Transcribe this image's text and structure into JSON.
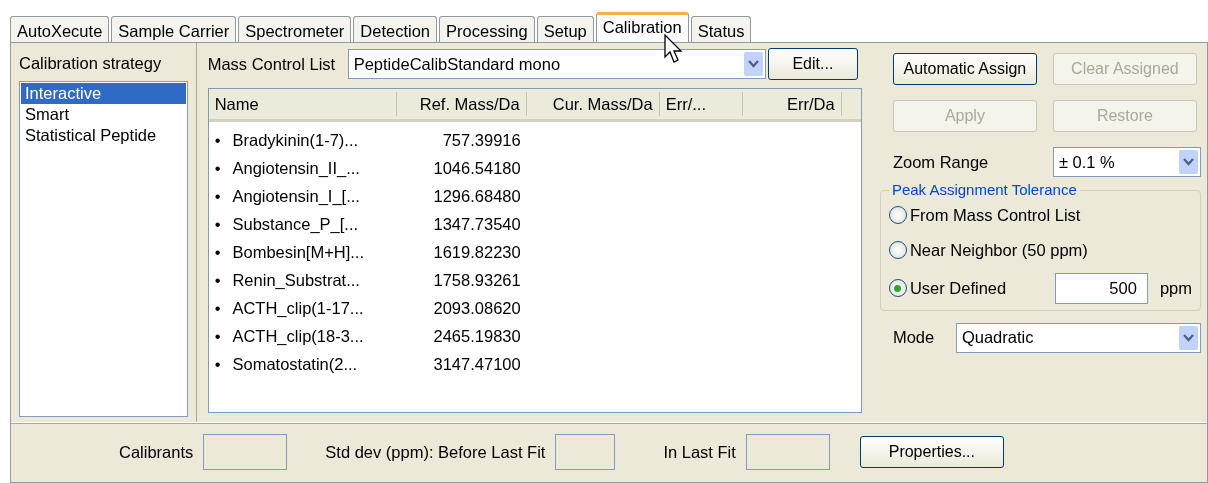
{
  "tabs": [
    {
      "label": "AutoXecute",
      "selected": false
    },
    {
      "label": "Sample Carrier",
      "selected": false
    },
    {
      "label": "Spectrometer",
      "selected": false
    },
    {
      "label": "Detection",
      "selected": false
    },
    {
      "label": "Processing",
      "selected": false
    },
    {
      "label": "Setup",
      "selected": false
    },
    {
      "label": "Calibration",
      "selected": true
    },
    {
      "label": "Status",
      "selected": false
    }
  ],
  "strategy": {
    "label": "Calibration strategy",
    "items": [
      {
        "label": "Interactive",
        "selected": true
      },
      {
        "label": "Smart",
        "selected": false
      },
      {
        "label": "Statistical Peptide",
        "selected": false
      }
    ]
  },
  "mass_control_list": {
    "label": "Mass Control List",
    "value": "PeptideCalibStandard mono",
    "edit_button": "Edit..."
  },
  "table": {
    "columns": [
      "Name",
      "Ref. Mass/Da",
      "Cur. Mass/Da",
      "Err/...",
      "Err/Da"
    ],
    "rows": [
      {
        "bullet": "•",
        "name": "Bradykinin(1-7)...",
        "ref_mass": "757.39916"
      },
      {
        "bullet": "•",
        "name": "Angiotensin_II_...",
        "ref_mass": "1046.54180"
      },
      {
        "bullet": "•",
        "name": "Angiotensin_I_[...",
        "ref_mass": "1296.68480"
      },
      {
        "bullet": "•",
        "name": "Substance_P_[...",
        "ref_mass": "1347.73540"
      },
      {
        "bullet": "•",
        "name": "Bombesin[M+H]...",
        "ref_mass": "1619.82230"
      },
      {
        "bullet": "•",
        "name": "Renin_Substrat...",
        "ref_mass": "1758.93261"
      },
      {
        "bullet": "•",
        "name": "ACTH_clip(1-17...",
        "ref_mass": "2093.08620"
      },
      {
        "bullet": "•",
        "name": "ACTH_clip(18-3...",
        "ref_mass": "2465.19830"
      },
      {
        "bullet": "•",
        "name": "Somatostatin(2...",
        "ref_mass": "3147.47100"
      }
    ]
  },
  "buttons": [
    {
      "label": "Automatic Assign",
      "disabled": false
    },
    {
      "label": "Clear Assigned",
      "disabled": true
    },
    {
      "label": "Apply",
      "disabled": true
    },
    {
      "label": "Restore",
      "disabled": true
    }
  ],
  "zoom_range": {
    "label": "Zoom Range",
    "value": "± 0.1 %"
  },
  "tolerance": {
    "title": "Peak Assignment Tolerance",
    "options": [
      {
        "label": "From Mass Control List",
        "selected": false
      },
      {
        "label": "Near Neighbor (50 ppm)",
        "selected": false
      },
      {
        "label": "User Defined",
        "selected": true
      }
    ],
    "value": "500",
    "unit": "ppm"
  },
  "mode": {
    "label": "Mode",
    "value": "Quadratic"
  },
  "status_bar": {
    "calibrants_label": "Calibrants",
    "std_dev_label": "Std dev (ppm): Before Last Fit",
    "last_fit_label": "In Last Fit",
    "properties_button": "Properties..."
  }
}
